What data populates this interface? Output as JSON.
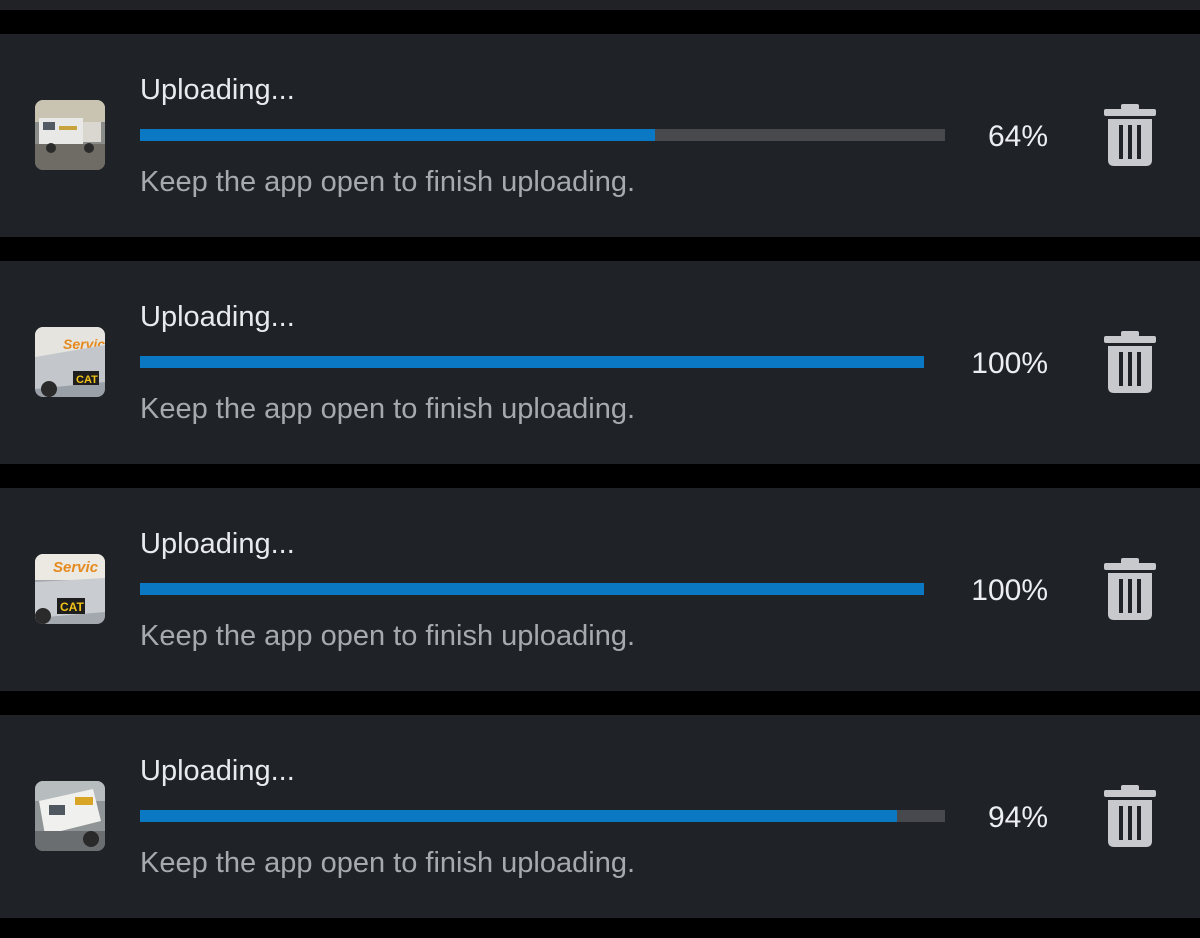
{
  "uploads": [
    {
      "status": "Uploading...",
      "message": "Keep the app open to finish uploading.",
      "percent_label": "64%",
      "progress": 0.64,
      "thumbnail_icon": "photo-thumbnail-icon",
      "delete_icon": "trash-icon"
    },
    {
      "status": "Uploading...",
      "message": "Keep the app open to finish uploading.",
      "percent_label": "100%",
      "progress": 1.0,
      "thumbnail_icon": "photo-thumbnail-icon",
      "delete_icon": "trash-icon"
    },
    {
      "status": "Uploading...",
      "message": "Keep the app open to finish uploading.",
      "percent_label": "100%",
      "progress": 1.0,
      "thumbnail_icon": "photo-thumbnail-icon",
      "delete_icon": "trash-icon"
    },
    {
      "status": "Uploading...",
      "message": "Keep the app open to finish uploading.",
      "percent_label": "94%",
      "progress": 0.94,
      "thumbnail_icon": "photo-thumbnail-icon",
      "delete_icon": "trash-icon"
    }
  ],
  "colors": {
    "progress_fill": "#0a78c3",
    "progress_track": "#47494d",
    "row_background": "#1f2226",
    "page_background": "#000000"
  }
}
